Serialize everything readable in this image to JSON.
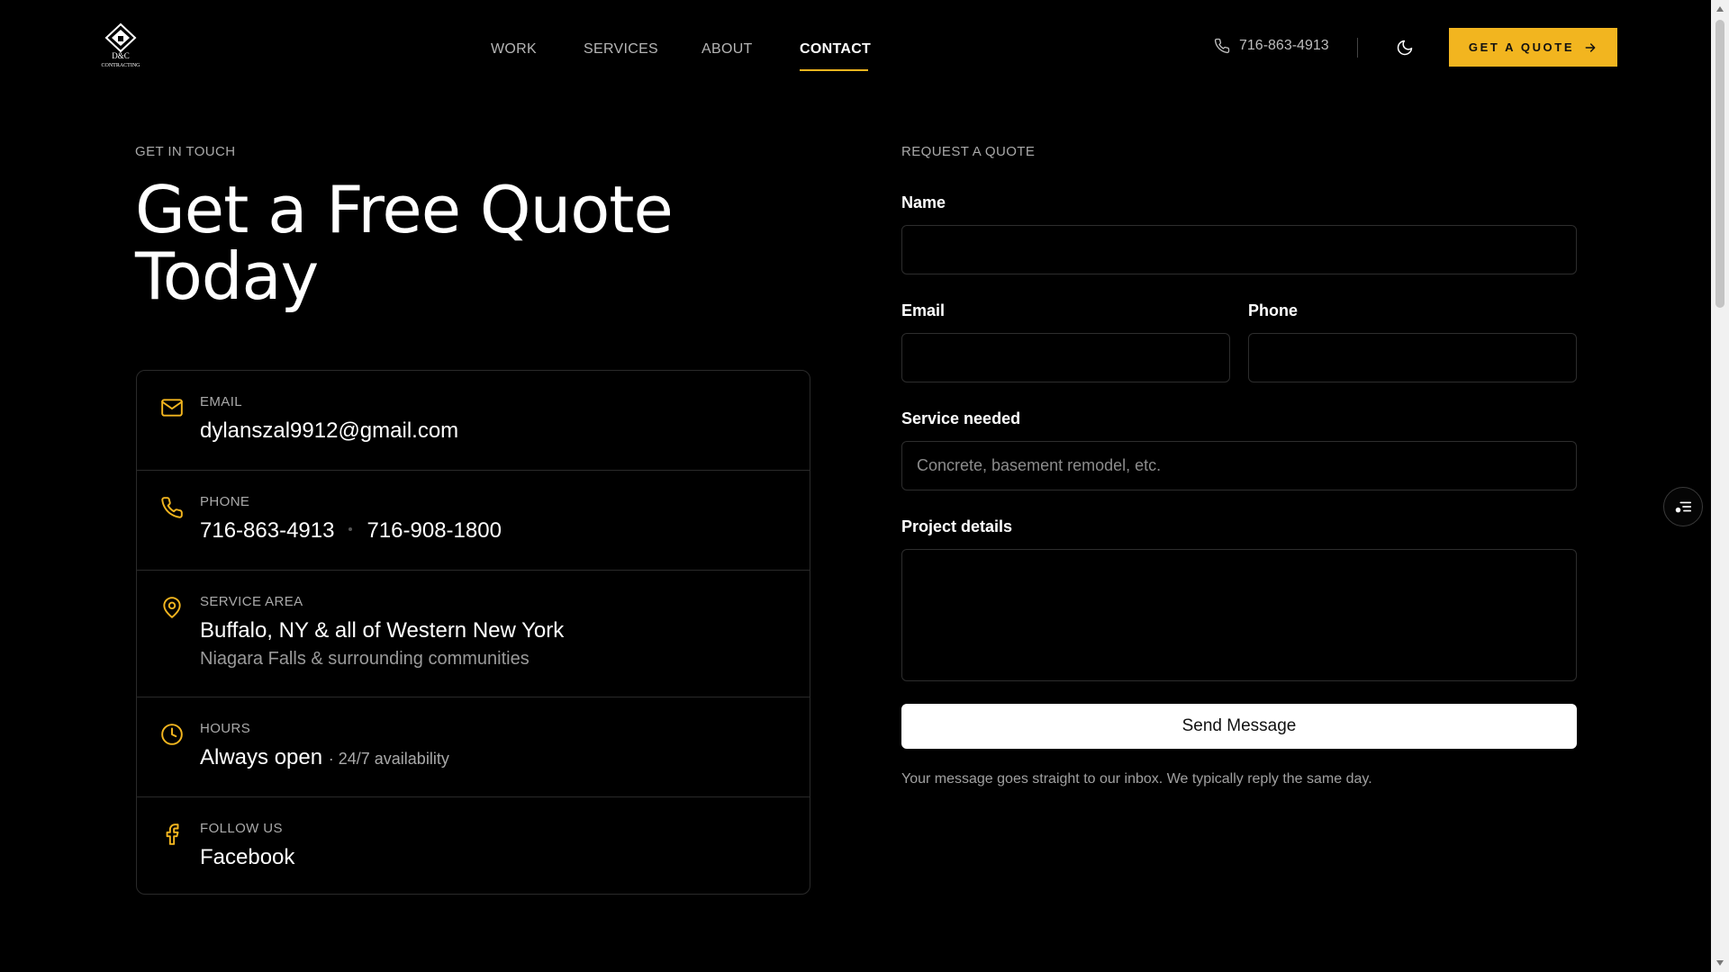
{
  "brand": {
    "logo_text": "D&C",
    "logo_subtext": "CONTRACTING",
    "colors": {
      "accent": "#f2b51f",
      "background": "#000000"
    }
  },
  "nav": {
    "items": [
      {
        "label": "WORK"
      },
      {
        "label": "SERVICES"
      },
      {
        "label": "ABOUT"
      },
      {
        "label": "CONTACT",
        "active": true
      }
    ]
  },
  "header": {
    "phone": "716-863-4913",
    "cta_label": "GET A QUOTE",
    "icons": [
      "phone-icon",
      "moon-icon",
      "arrow-right-icon"
    ]
  },
  "contact": {
    "eyebrow": "GET IN TOUCH",
    "title_line1": "Get a Free Quote",
    "title_line2": "Today",
    "email": {
      "label": "EMAIL",
      "value": "dylanszal9912@gmail.com",
      "icon": "mail-icon"
    },
    "phone": {
      "label": "PHONE",
      "primary": "716-863-4913",
      "secondary": "716-908-1800",
      "icon": "phone-icon"
    },
    "service_area": {
      "label": "SERVICE AREA",
      "value": "Buffalo, NY & all of Western New York",
      "sub": "Niagara Falls & surrounding communities",
      "icon": "map-pin-icon"
    },
    "hours": {
      "label": "HOURS",
      "value": "Always open",
      "note": "· 24/7 availability",
      "icon": "clock-icon"
    },
    "follow": {
      "label": "FOLLOW US",
      "value": "Facebook",
      "icon": "facebook-icon"
    }
  },
  "form": {
    "eyebrow": "REQUEST A QUOTE",
    "name_label": "Name",
    "name_value": "",
    "email_label": "Email",
    "email_value": "",
    "phone_label": "Phone",
    "phone_value": "",
    "service_label": "Service needed",
    "service_placeholder": "Concrete, basement remodel, etc.",
    "details_label": "Project details",
    "details_value": "",
    "submit_label": "Send Message",
    "note": "Your message goes straight to our inbox. We typically reply the same day."
  }
}
